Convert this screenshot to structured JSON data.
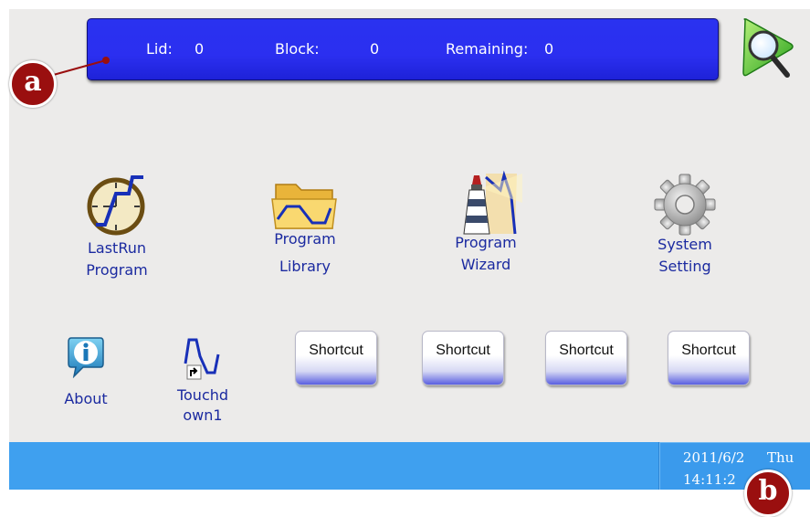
{
  "status": {
    "lid_label": "Lid:",
    "lid_value": "0",
    "block_label": "Block:",
    "block_value": "0",
    "remaining_label": "Remaining:",
    "remaining_value": "0"
  },
  "main_items": [
    {
      "line1": "LastRun",
      "line2": "Program",
      "icon": "lastrun-program-icon"
    },
    {
      "line1": "Program",
      "line2": "Library",
      "icon": "folder-icon"
    },
    {
      "line1": "Program",
      "line2": "Wizard",
      "icon": "lighthouse-icon"
    },
    {
      "line1": "System",
      "line2": "Setting",
      "icon": "gear-icon"
    }
  ],
  "about": {
    "label": "About",
    "icon": "info-icon"
  },
  "touchdown": {
    "line1": "Touchd",
    "line2": "own1",
    "icon": "touchdown-shortcut-icon"
  },
  "shortcuts": [
    "Shortcut",
    "Shortcut",
    "Shortcut",
    "Shortcut"
  ],
  "clock": {
    "date": "2011/6/2",
    "day": "Thu",
    "time": "14:11:2"
  },
  "callouts": {
    "a": "a",
    "b": "b"
  },
  "colors": {
    "screen_bg": "#ecebea",
    "status_panel": "#2b2ff0",
    "label_text": "#1b2aa0",
    "taskbar": "#3fa0ef",
    "callout": "#9a0f0f"
  }
}
